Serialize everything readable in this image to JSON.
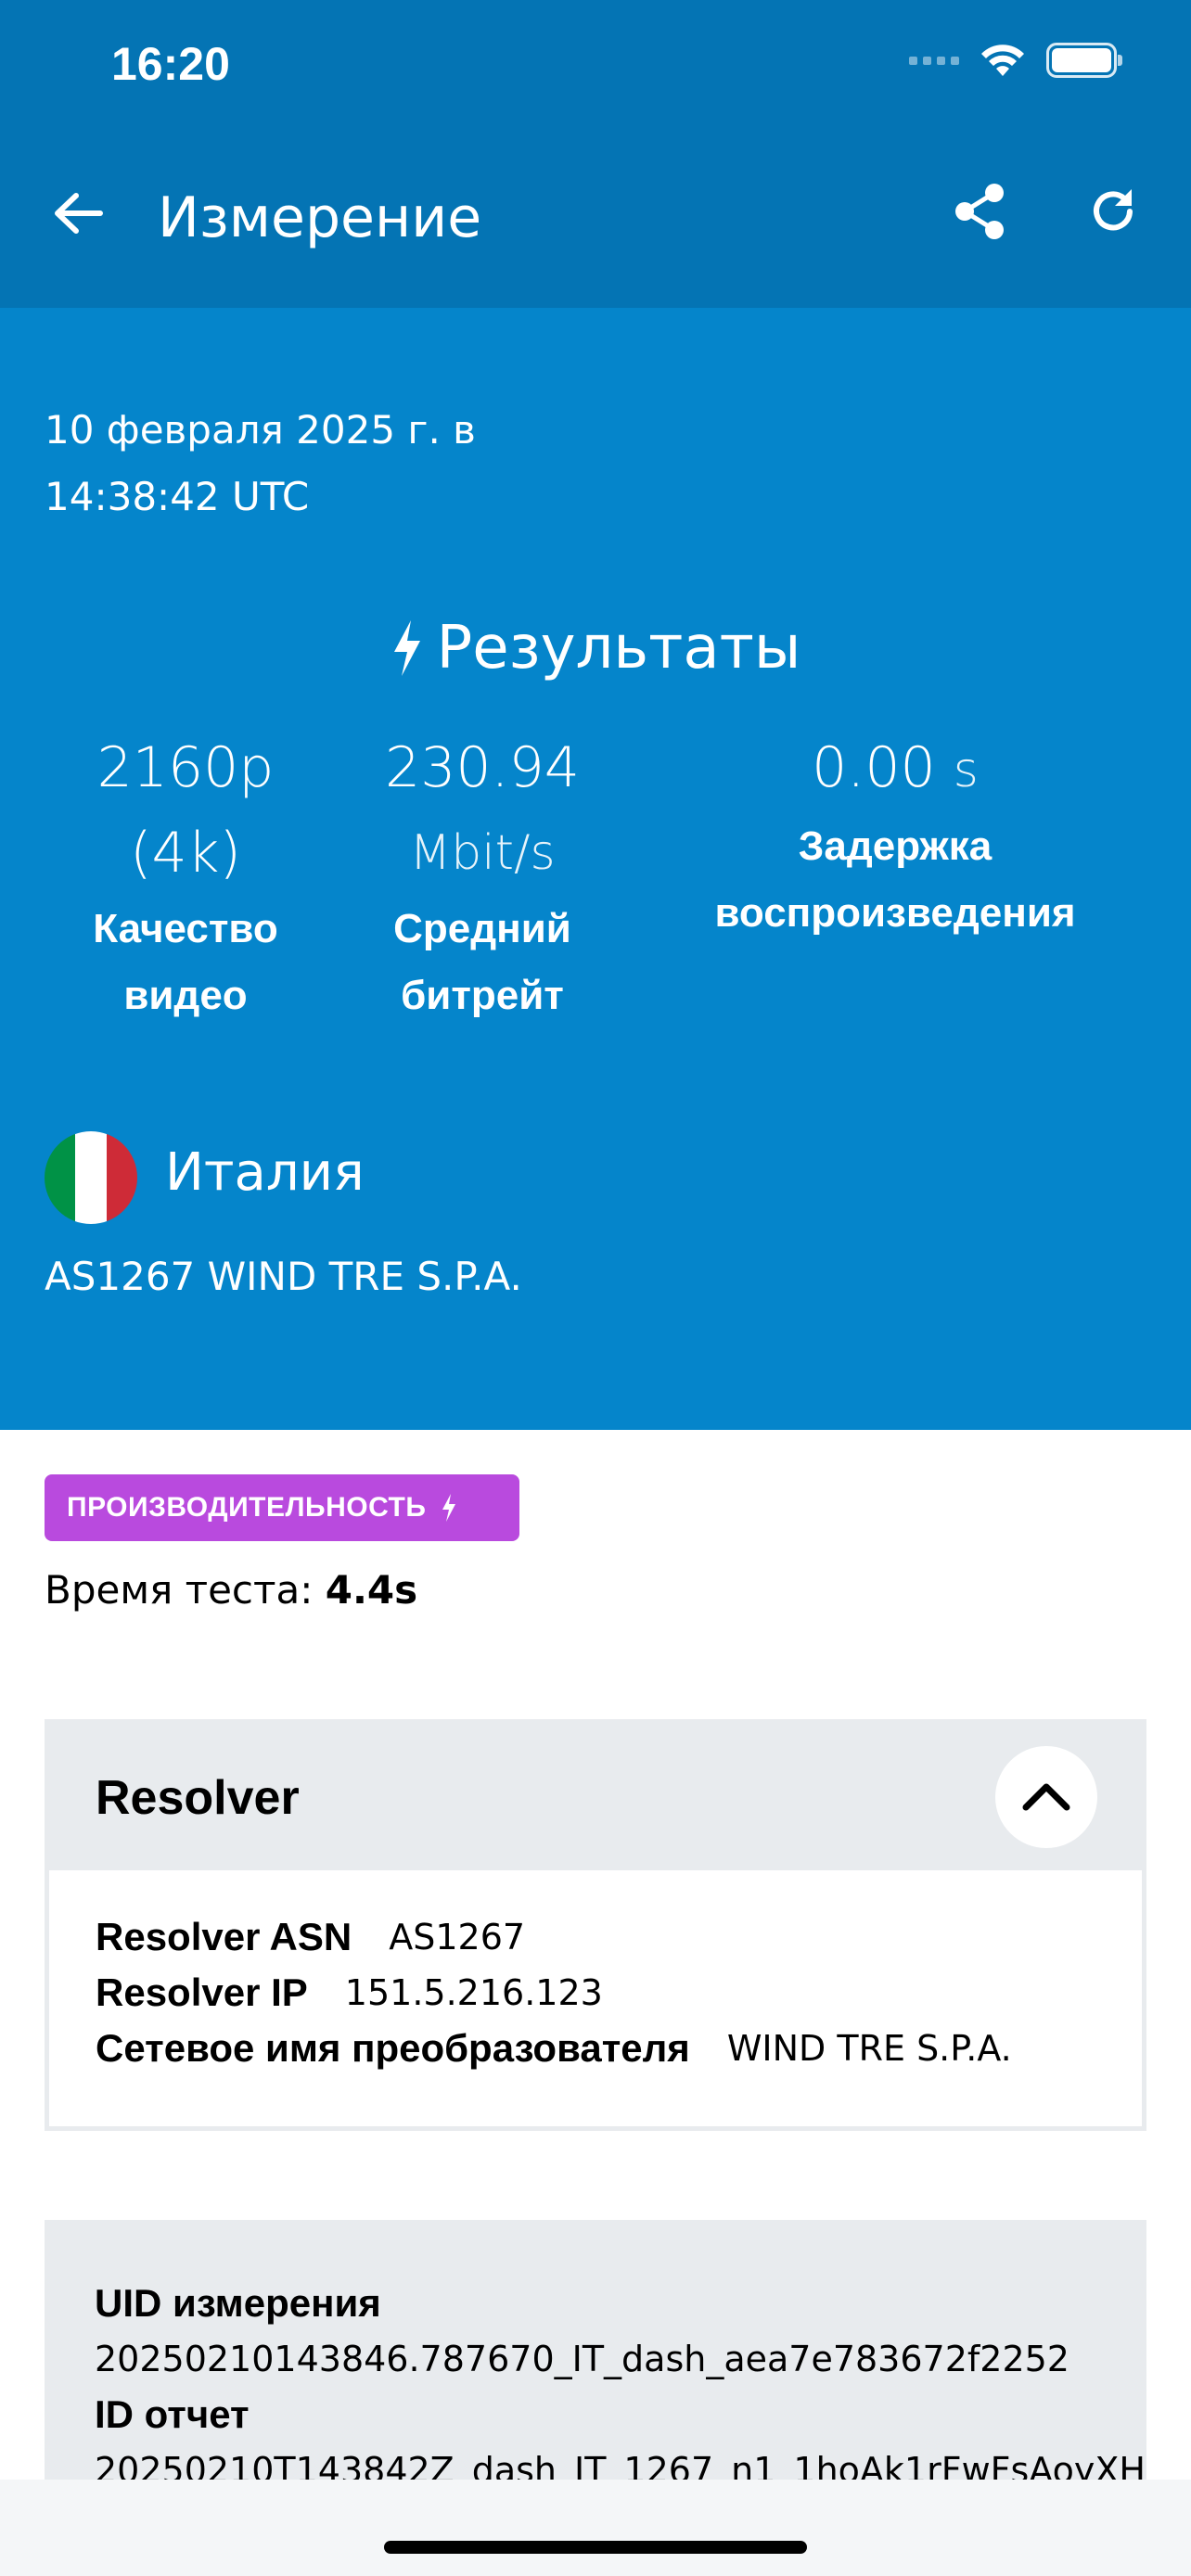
{
  "status_bar": {
    "time": "16:20"
  },
  "app_bar": {
    "title": "Измерение"
  },
  "hero": {
    "date": "10 февраля 2025 г. в 14:38:42 UTC",
    "results_title": "Результаты",
    "metrics": [
      {
        "value": "2160p (4k)",
        "unit": "",
        "label": "Качество видео"
      },
      {
        "value": "230.94",
        "unit": "Mbit/s",
        "label": "Средний битрейт"
      },
      {
        "value": "0.00",
        "unit": "s",
        "label": "Задержка воспроизведения"
      }
    ],
    "country": "Италия",
    "network": "AS1267 WIND TRE S.P.A.",
    "flag_colors": [
      "#009246",
      "#ffffff",
      "#ce2b37"
    ]
  },
  "badge": {
    "label": "ПРОИЗВОДИТЕЛЬНОСТЬ",
    "color": "#b94ade"
  },
  "test_time": {
    "label": "Время теста:",
    "value": "4.4s"
  },
  "resolver": {
    "title": "Resolver",
    "rows": [
      {
        "key": "Resolver ASN",
        "value": "AS1267"
      },
      {
        "key": "Resolver IP",
        "value": "151.5.216.123"
      },
      {
        "key": "Сетевое имя преобразователя",
        "value": "WIND TRE S.P.A."
      }
    ]
  },
  "measurement": {
    "uid_label": "UID измерения",
    "uid_value": "20250210143846.787670_IT_dash_aea7e783672f2252",
    "report_label": "ID отчет",
    "report_value": "20250210T143842Z_dash_IT_1267_n1_1hoAk1rFwFsAoyXH"
  },
  "colors": {
    "app_bar": "#0474b4",
    "hero": "#0585cb",
    "card": "#e8ebee"
  }
}
